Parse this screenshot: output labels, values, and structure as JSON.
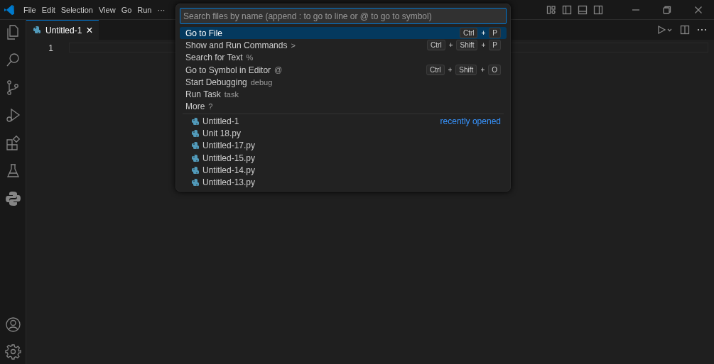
{
  "menu": [
    "File",
    "Edit",
    "Selection",
    "View",
    "Go",
    "Run",
    "···"
  ],
  "tabs": [
    {
      "label": "Untitled-1",
      "selected": true
    }
  ],
  "tab_close": "×",
  "line_numbers": [
    "1"
  ],
  "quick_open": {
    "placeholder": "Search files by name (append : to go to line or @ to go to symbol)",
    "key_joiner": "+",
    "commands": [
      {
        "label": "Go to File",
        "keys": [
          "Ctrl",
          "P"
        ],
        "selected": true
      },
      {
        "label": "Show and Run Commands",
        "hint": ">",
        "keys": [
          "Ctrl",
          "Shift",
          "P"
        ],
        "selected": false
      },
      {
        "label": "Search for Text",
        "hint": "%",
        "selected": false
      },
      {
        "label": "Go to Symbol in Editor",
        "hint": "@",
        "keys": [
          "Ctrl",
          "Shift",
          "O"
        ],
        "selected": false
      },
      {
        "label": "Start Debugging",
        "hint": "debug",
        "selected": false
      },
      {
        "label": "Run Task",
        "hint": "task",
        "selected": false
      },
      {
        "label": "More",
        "hint": "?",
        "selected": false
      }
    ],
    "files": [
      {
        "name": "Untitled-1",
        "note": "recently opened"
      },
      {
        "name": "Unit 18.py"
      },
      {
        "name": "Untitled-17.py"
      },
      {
        "name": "Untitled-15.py"
      },
      {
        "name": "Untitled-14.py"
      },
      {
        "name": "Untitled-13.py"
      }
    ]
  }
}
